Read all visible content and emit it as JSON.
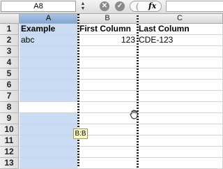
{
  "formula_bar": {
    "name_box": "A8",
    "stepper_icon": "up-down-arrows",
    "cancel_icon": "x-circle",
    "ok_icon": "check-circle",
    "fx_label": "fx",
    "formula": ""
  },
  "columns": [
    {
      "label": "A",
      "selected": true
    },
    {
      "label": "B",
      "selected": false
    },
    {
      "label": "C",
      "selected": false
    }
  ],
  "rows": [
    "1",
    "2",
    "3",
    "4",
    "5",
    "6",
    "7",
    "8",
    "9",
    "10",
    "11",
    "12",
    "13"
  ],
  "cells": {
    "A1": "Example",
    "B1": "First Column",
    "C1": "Last Column",
    "A2": "abc",
    "B2": "123",
    "C2": "CDE-123"
  },
  "tooltip": "B:B",
  "colors": {
    "selection": "#c9dcf3",
    "selected_header": "#9bb8de",
    "tooltip_bg": "#fffbc4"
  },
  "cursor_icon": "grab-hand"
}
